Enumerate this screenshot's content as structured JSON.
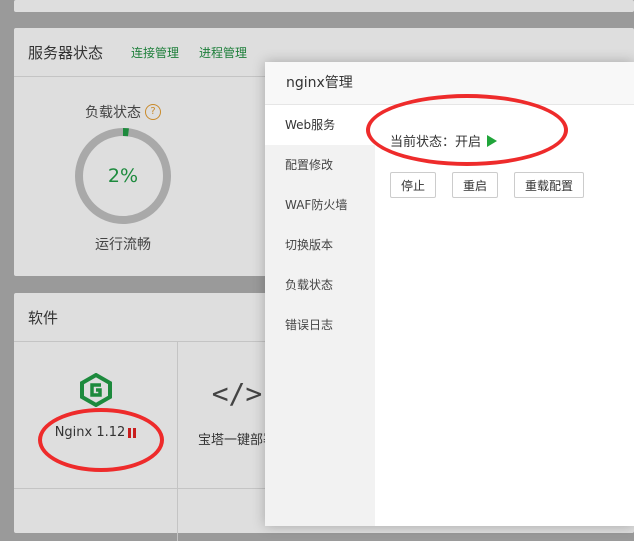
{
  "dashboard": {
    "status_card": {
      "title": "服务器状态",
      "links": [
        "连接管理",
        "进程管理"
      ],
      "load": {
        "label": "负载状态",
        "help_icon": "question-circle-icon",
        "percent_text": "2%",
        "percent_value": 2,
        "status_text": "运行流畅"
      }
    },
    "software_card": {
      "title": "软件",
      "items": [
        {
          "name": "Nginx 1.12",
          "icon": "nginx-logo-icon",
          "state_icon": "pause-icon"
        },
        {
          "name": "宝塔一键部署",
          "icon": "code-icon"
        }
      ]
    }
  },
  "modal": {
    "title": "nginx管理",
    "sidebar": [
      "Web服务",
      "配置修改",
      "WAF防火墙",
      "切换版本",
      "负载状态",
      "错误日志"
    ],
    "active_index": 0,
    "status_label": "当前状态：开启",
    "status_icon": "play-icon",
    "buttons": {
      "stop": "停止",
      "restart": "重启",
      "reload": "重载配置"
    }
  },
  "colors": {
    "accent_green": "#20a53a",
    "annotation_red": "#ee2b2b",
    "nginx_green": "#1d8a3d"
  }
}
